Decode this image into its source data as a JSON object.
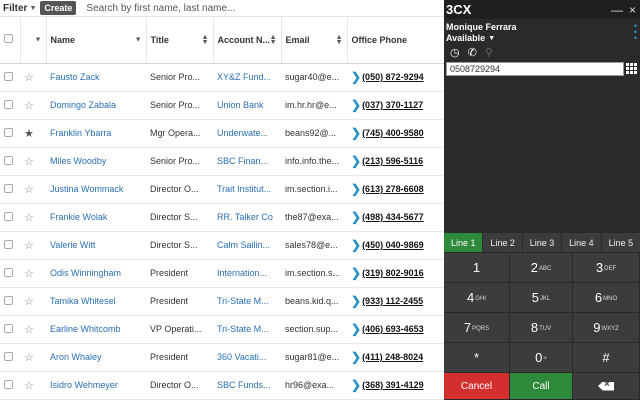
{
  "toolbar": {
    "filter_label": "Filter",
    "create_label": "Create",
    "search_placeholder": "Search by first name, last name..."
  },
  "table": {
    "columns": [
      "Name",
      "Title",
      "Account N...",
      "Email",
      "Office Phone"
    ],
    "rows": [
      {
        "name": "Fausto Zack",
        "title": "Senior Pro...",
        "account": "XY&Z Fund...",
        "email": "sugar40@e...",
        "phone": "(050) 872-9294",
        "starred": false
      },
      {
        "name": "Domingo Zabala",
        "title": "Senior Pro...",
        "account": "Union Bank",
        "email": "im.hr.hr@e...",
        "phone": "(037) 370-1127",
        "starred": false
      },
      {
        "name": "Franklin Ybarra",
        "title": "Mgr Opera...",
        "account": "Underwate...",
        "email": "beans92@...",
        "phone": "(745) 400-9580",
        "starred": true
      },
      {
        "name": "Miles Woodby",
        "title": "Senior Pro...",
        "account": "SBC Finan...",
        "email": "info.info.the...",
        "phone": "(213) 596-5116",
        "starred": false
      },
      {
        "name": "Justina Wommack",
        "title": "Director O...",
        "account": "Trait Institut...",
        "email": "im.section.i...",
        "phone": "(613) 278-6608",
        "starred": false
      },
      {
        "name": "Frankie Wolak",
        "title": "Director S...",
        "account": "RR. Talker Co",
        "email": "the87@exa...",
        "phone": "(498) 434-5677",
        "starred": false
      },
      {
        "name": "Valerie Witt",
        "title": "Director S...",
        "account": "Calm Sailin...",
        "email": "sales78@e...",
        "phone": "(450) 040-9869",
        "starred": false
      },
      {
        "name": "Odis Winningham",
        "title": "President",
        "account": "Internation...",
        "email": "im.section.s...",
        "phone": "(319) 802-9016",
        "starred": false
      },
      {
        "name": "Tamika Whitesel",
        "title": "President",
        "account": "Tri-State M...",
        "email": "beans.kid.q...",
        "phone": "(933) 112-2455",
        "starred": false
      },
      {
        "name": "Earline Whitcomb",
        "title": "VP Operati...",
        "account": "Tri-State M...",
        "email": "section.sup...",
        "phone": "(406) 693-4653",
        "starred": false
      },
      {
        "name": "Aron Whaley",
        "title": "President",
        "account": "360 Vacati...",
        "email": "sugar81@e...",
        "phone": "(411) 248-8024",
        "starred": false
      },
      {
        "name": "Isidro Wehmeyer",
        "title": "Director O...",
        "account": "SBC Funds...",
        "email": "hr96@exa...",
        "phone": "(368) 391-4129",
        "starred": false
      }
    ]
  },
  "softphone": {
    "logo_digit": "3",
    "logo_text": "CX",
    "minimize": "—",
    "close": "×",
    "username": "Monique Ferrara",
    "status": "Available",
    "dial_value": "0508729294",
    "lines": [
      "Line 1",
      "Line 2",
      "Line 3",
      "Line 4",
      "Line 5"
    ],
    "active_line": 0,
    "keys": [
      {
        "digit": "1",
        "letters": ""
      },
      {
        "digit": "2",
        "letters": "ABC"
      },
      {
        "digit": "3",
        "letters": "DEF"
      },
      {
        "digit": "4",
        "letters": "GHI"
      },
      {
        "digit": "5",
        "letters": "JKL"
      },
      {
        "digit": "6",
        "letters": "MNO"
      },
      {
        "digit": "7",
        "letters": "PQRS"
      },
      {
        "digit": "8",
        "letters": "TUV"
      },
      {
        "digit": "9",
        "letters": "WXYZ"
      },
      {
        "digit": "*",
        "letters": ""
      },
      {
        "digit": "0",
        "letters": "+"
      },
      {
        "digit": "#",
        "letters": ""
      }
    ],
    "cancel_label": "Cancel",
    "call_label": "Call",
    "colors": {
      "accent": "#2a95c4",
      "call": "#2e8a3a",
      "cancel": "#d32f2f",
      "panel": "#2a2a2a"
    }
  }
}
